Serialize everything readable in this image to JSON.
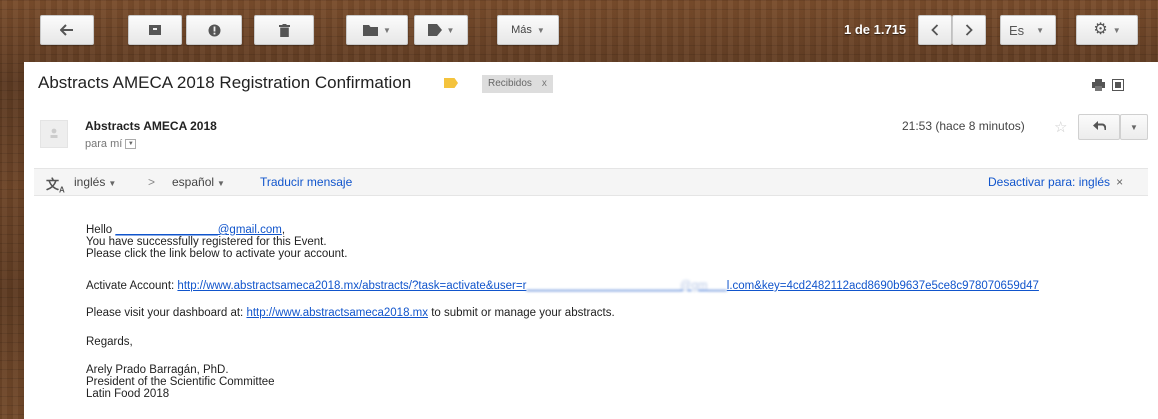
{
  "toolbar": {
    "more_label": "Más",
    "pager_text": "1 de 1.715",
    "lang_label": "Es",
    "icons": {
      "back": "arrow-left-icon",
      "archive": "archive-icon",
      "spam": "report-spam-icon",
      "delete": "trash-icon",
      "move": "folder-icon",
      "labels": "tag-icon",
      "prev": "chevron-left-icon",
      "next": "chevron-right-icon",
      "settings": "gear-icon"
    }
  },
  "email": {
    "subject": "Abstracts AMECA 2018 Registration Confirmation",
    "label_color": "#f4c33d",
    "inbox_chip": "Recibidos",
    "inbox_chip_close": "x",
    "sender": "Abstracts AMECA 2018",
    "to": "para mí",
    "timestamp": "21:53 (hace 8 minutos)"
  },
  "translate_bar": {
    "from_lang": "inglés",
    "arrow": ">",
    "to_lang": "español",
    "translate_link": "Traducir mensaje",
    "disable_link": "Desactivar para: inglés",
    "close": "×"
  },
  "body": {
    "hello": "Hello",
    "hello_email": "________________@gmail.com",
    "hello_suffix": ",",
    "line2": "You have successfully registered for this Event.",
    "line3": "Please click the link below to activate your account.",
    "activate_label": "Activate Account:",
    "activate_link_start": "http://www.abstractsameca2018.mx/abstracts/?task=activate&user=r",
    "activate_link_blurred": "________________________@gm___",
    "activate_link_end": "l.com&key=4cd2482112acd8690b9637e5ce8c978070659d47",
    "dashboard_prefix": "Please visit your dashboard at:",
    "dashboard_link": "http://www.abstractsameca2018.mx",
    "dashboard_suffix": "to submit or manage your abstracts.",
    "regards": "Regards,",
    "sig1": "Arely Prado Barragán, PhD.",
    "sig2": "President of the Scientific Committee",
    "sig3": "Latin Food 2018"
  },
  "colors": {
    "link": "#1155cc",
    "wood": "#6b4428"
  }
}
